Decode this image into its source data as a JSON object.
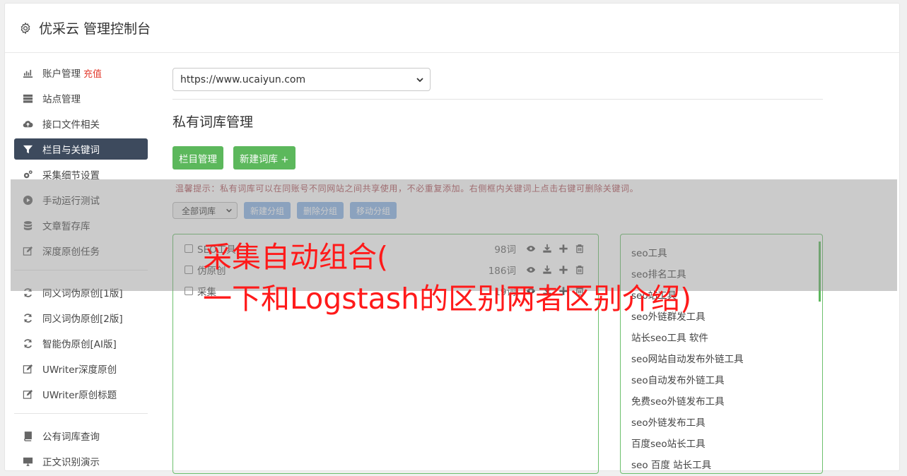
{
  "header": {
    "title": "优采云 管理控制台",
    "icon": "gear-icon"
  },
  "sidebar": {
    "groups": [
      [
        {
          "label": "账户管理",
          "badge": "充值",
          "icon": "bar-chart-icon"
        },
        {
          "label": "站点管理",
          "icon": "server-icon"
        },
        {
          "label": "接口文件相关",
          "icon": "cloud-upload-icon"
        },
        {
          "label": "栏目与关键词",
          "icon": "filter-icon",
          "active": true
        },
        {
          "label": "采集细节设置",
          "icon": "gears-icon"
        },
        {
          "label": "手动运行测试",
          "icon": "play-icon"
        },
        {
          "label": "文章暂存库",
          "icon": "database-icon"
        },
        {
          "label": "深度原创任务",
          "icon": "edit-icon"
        }
      ],
      [
        {
          "label": "同义词伪原创[1版]",
          "icon": "refresh-icon"
        },
        {
          "label": "同义词伪原创[2版]",
          "icon": "refresh-icon"
        },
        {
          "label": "智能伪原创[AI版]",
          "icon": "refresh-icon"
        },
        {
          "label": "UWriter深度原创",
          "icon": "edit-icon"
        },
        {
          "label": "UWriter原创标题",
          "icon": "edit-icon"
        }
      ],
      [
        {
          "label": "公有词库查询",
          "icon": "book-icon"
        },
        {
          "label": "正文识别演示",
          "icon": "monitor-icon"
        }
      ]
    ]
  },
  "main": {
    "site_select": "https://www.ucaiyun.com",
    "section_title": "私有词库管理",
    "btn_columns": "栏目管理",
    "btn_new_lib": "新建词库 +",
    "tip": "温馨提示：私有词库可以在同账号不同网站之间共享使用，不必重复添加。右侧框内关键词上点击右键可删除关键词。",
    "filter_select": "全部词库",
    "btn_new_group": "新建分组",
    "btn_delete_group": "删除分组",
    "btn_move_group": "移动分组",
    "libraries": [
      {
        "name": "SEO工具",
        "count": "98词"
      },
      {
        "name": "伪原创",
        "count": "186词"
      },
      {
        "name": "采集",
        "count": "19词"
      }
    ],
    "keywords": [
      "seo工具",
      "seo排名工具",
      "seo站工具",
      "seo外链群发工具",
      "站长seo工具 软件",
      "seo网站自动发布外链工具",
      "seo自动发布外链工具",
      "免费seo外链发布工具",
      "seo外链发布工具",
      "百度seo站长工具",
      "seo 百度 站长工具"
    ]
  },
  "overlay": {
    "line1": "采集自动组合(",
    "line2": "一下和Logstash的区别两者区别介绍)",
    "color": "#ff1a1a"
  }
}
